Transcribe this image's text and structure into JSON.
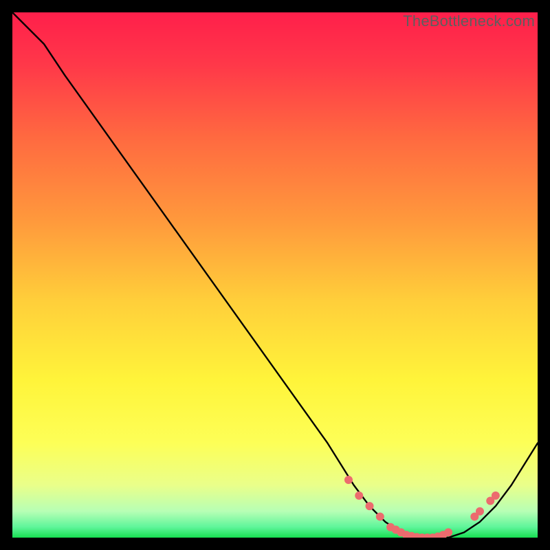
{
  "watermark": "TheBottleneck.com",
  "chart_data": {
    "type": "line",
    "title": "",
    "xlabel": "",
    "ylabel": "",
    "xlim": [
      0,
      100
    ],
    "ylim": [
      0,
      100
    ],
    "grid": false,
    "colors": {
      "gradient_top": "#ff1f4b",
      "gradient_mid_upper": "#ff7a3c",
      "gradient_mid": "#ffd23a",
      "gradient_mid_lower": "#fff93a",
      "gradient_lower": "#e9ff6e",
      "gradient_bottom": "#1fe05a",
      "line": "#000000",
      "marker": "#ec6b6e"
    },
    "curve": {
      "description": "Bottleneck curve: starts high on the left, slight kink then steep near-linear descent to a trough at ~x=78, flat minimum, then rises toward the right edge.",
      "x": [
        0,
        6,
        10,
        20,
        30,
        40,
        50,
        60,
        65,
        68,
        71,
        74,
        77,
        80,
        83,
        86,
        89,
        92,
        95,
        100
      ],
      "y": [
        100,
        94,
        88,
        74,
        60,
        46,
        32,
        18,
        10,
        6,
        3,
        1,
        0,
        0,
        0,
        1,
        3,
        6,
        10,
        18
      ]
    },
    "markers": {
      "description": "Dots along the trough region of the curve (salmon colored).",
      "x": [
        64,
        66,
        68,
        70,
        72,
        73,
        74,
        75,
        76,
        77,
        78,
        79,
        80,
        81,
        82,
        83,
        88,
        89,
        91,
        92
      ],
      "y": [
        11,
        8,
        6,
        4,
        2,
        1.5,
        1,
        0.5,
        0.3,
        0.1,
        0,
        0,
        0,
        0.2,
        0.5,
        1,
        4,
        5,
        7,
        8
      ]
    }
  }
}
